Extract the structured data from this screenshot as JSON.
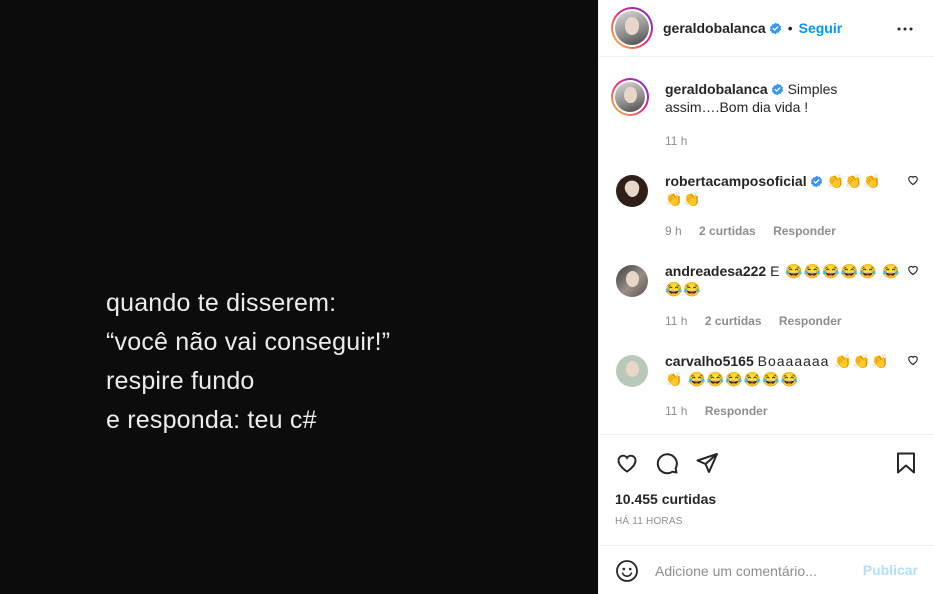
{
  "media": {
    "lines": [
      "quando te disserem:",
      "“você não vai conseguir!”",
      "respire fundo",
      "e responda: teu c#"
    ]
  },
  "header": {
    "username": "geraldobalanca",
    "dot": "•",
    "follow_label": "Seguir",
    "more_icon": "more-horizontal-icon",
    "verified_color": "#3897f0"
  },
  "caption": {
    "username": "geraldobalanca",
    "text": "Simples assim….Bom dia vida !",
    "time": "11 h"
  },
  "comments": [
    {
      "username": "robertacamposoficial",
      "verified": true,
      "text": "👏👏👏 👏👏",
      "time": "9 h",
      "likes": "2 curtidas",
      "reply": "Responder"
    },
    {
      "username": "andreadesa222",
      "verified": false,
      "text": "E 😂😂😂😂😂 😂😂😂",
      "time": "11 h",
      "likes": "2 curtidas",
      "reply": "Responder"
    },
    {
      "username": "carvalho5165",
      "verified": false,
      "text": "Boaaaaaa 👏👏👏👏 😂😂😂😂😂😂",
      "time": "11 h",
      "likes": "",
      "reply": "Responder"
    }
  ],
  "actions": {
    "like_icon": "heart-icon",
    "comment_icon": "comment-icon",
    "share_icon": "send-icon",
    "save_icon": "bookmark-icon",
    "likes_count": "10.455 curtidas",
    "posted_ago": "HÁ 11 HORAS"
  },
  "add_comment": {
    "placeholder": "Adicione um comentário...",
    "publish_label": "Publicar",
    "publish_color": "#b2dffc"
  }
}
